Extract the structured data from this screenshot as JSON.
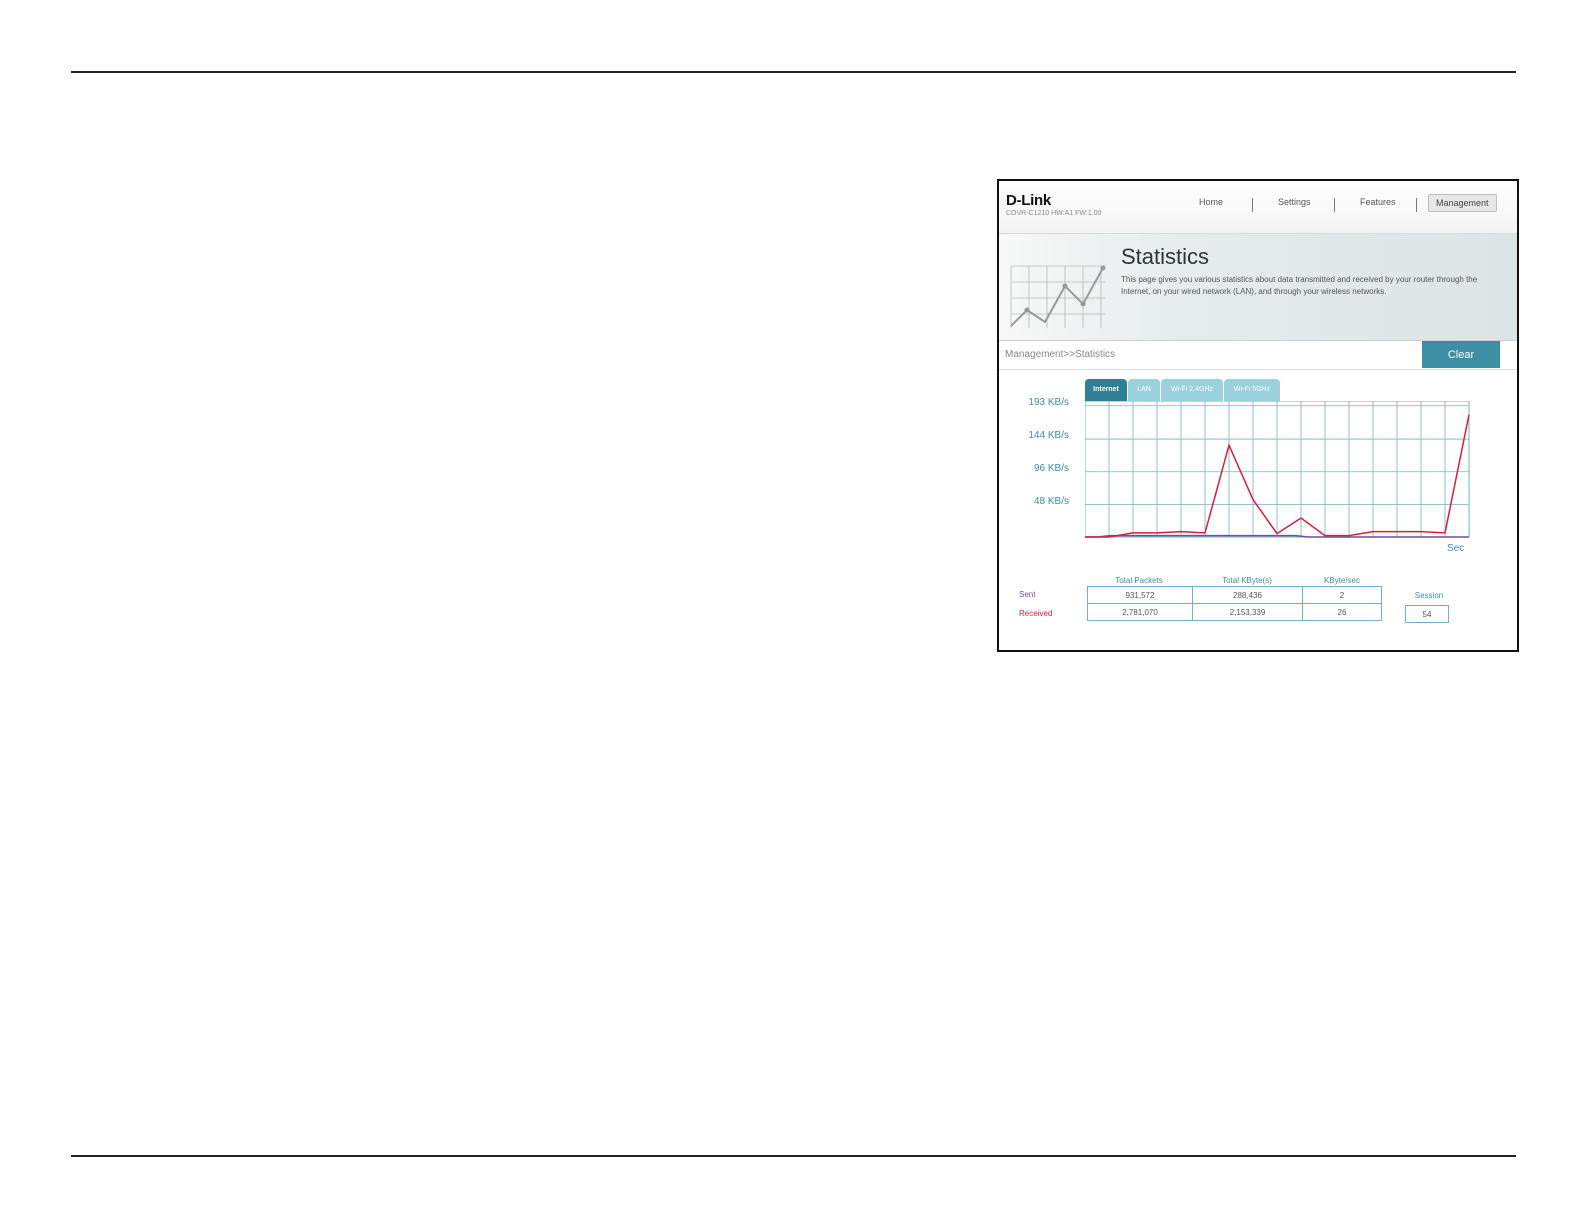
{
  "header": {
    "logo": "D-Link",
    "model": "COVR-C1210 HW:A1 FW:1.00",
    "nav": [
      "Home",
      "Settings",
      "Features",
      "Management"
    ]
  },
  "banner": {
    "title": "Statistics",
    "description": "This page gives you various statistics about data transmitted and received by your router through the Internet, on your wired network (LAN), and through your wireless networks."
  },
  "breadcrumb": "Management>>Statistics",
  "clear_label": "Clear",
  "tabs": [
    "Internet",
    "LAN",
    "Wi-Fi 2.4GHz",
    "Wi-Fi 5GHz"
  ],
  "active_tab": "Internet",
  "colors": {
    "sent": "#6a4fa3",
    "received": "#d61f3c",
    "grid": "#6fb3c6",
    "accent": "#3d8fa5"
  },
  "chart_data": {
    "type": "line",
    "y_tick_labels": [
      "193 KB/s",
      "144 KB/s",
      "96 KB/s",
      "48 KB/s"
    ],
    "y_ticks": [
      193,
      144,
      96,
      48
    ],
    "ylim": [
      0,
      200
    ],
    "xlabel": "Sec",
    "series": [
      {
        "name": "Sent",
        "values": [
          0,
          0,
          2,
          2,
          2,
          2,
          2,
          2,
          2,
          2,
          2,
          2,
          2,
          2,
          2,
          2,
          2,
          2,
          0,
          0,
          0,
          0,
          0,
          0,
          0,
          0,
          0,
          0,
          0,
          0,
          0,
          0
        ]
      },
      {
        "name": "Received",
        "values": [
          0,
          0,
          6,
          6,
          8,
          6,
          135,
          55,
          5,
          28,
          2,
          2,
          8,
          8,
          8,
          6,
          180
        ]
      }
    ]
  },
  "table": {
    "headers": [
      "Total Packets",
      "Total KByte(s)",
      "KByte/sec"
    ],
    "rows": [
      {
        "label": "Sent",
        "values": [
          "931,572",
          "288,436",
          "2"
        ]
      },
      {
        "label": "Received",
        "values": [
          "2,781,070",
          "2,153,339",
          "26"
        ]
      }
    ],
    "session_label": "Session",
    "session_value": "54"
  }
}
